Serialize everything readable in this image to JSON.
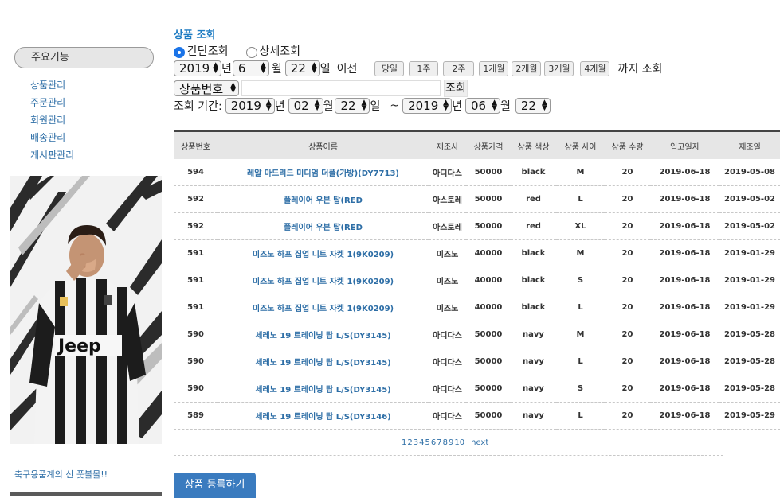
{
  "sidebar": {
    "menu_title": "주요기능",
    "items": [
      {
        "label": "상품관리"
      },
      {
        "label": "주문관리"
      },
      {
        "label": "회원관리"
      },
      {
        "label": "배송관리"
      },
      {
        "label": "게시판관리"
      }
    ],
    "caption": "축구용품계의 신 풋볼몰!!"
  },
  "search": {
    "title": "상품 조회",
    "radio_simple": "간단조회",
    "radio_detail": "상세조회",
    "selected_mode": "간단조회",
    "date": {
      "year": "2019",
      "month": "6",
      "day": "22"
    },
    "unit_year": "년",
    "unit_month": "월",
    "unit_day": "일",
    "before_label": "이전",
    "quick_buttons": [
      "당일",
      "1주",
      "2주",
      "1개월",
      "2개월",
      "3개월",
      "4개월"
    ],
    "until_label": "까지 조회",
    "field_select": "상품번호",
    "keyword": "",
    "search_button": "조회",
    "period_label": "조회 기간:",
    "period_from": {
      "year": "2019",
      "month": "02",
      "day": "22"
    },
    "tilde": "~",
    "period_to": {
      "year": "2019",
      "month": "06",
      "day": "22"
    }
  },
  "table": {
    "headers": [
      "상품번호",
      "상품이름",
      "제조사",
      "상품가격",
      "상품 색상",
      "상품 사이",
      "상품 수량",
      "입고일자",
      "제조일"
    ],
    "rows": [
      [
        "594",
        "레알 마드리드 미디엄 더플(가방)(DY7713)",
        "아디다스",
        "50000",
        "black",
        "M",
        "20",
        "2019-06-18",
        "2019-05-08"
      ],
      [
        "592",
        "플레이어 우븐 탑(RED",
        "아스토레",
        "50000",
        "red",
        "L",
        "20",
        "2019-06-18",
        "2019-05-02"
      ],
      [
        "592",
        "플레이어 우븐 탑(RED",
        "아스토레",
        "50000",
        "red",
        "XL",
        "20",
        "2019-06-18",
        "2019-05-02"
      ],
      [
        "591",
        "미즈노 하프 집업 니트 자켓 1(9K0209)",
        "미즈노",
        "40000",
        "black",
        "M",
        "20",
        "2019-06-18",
        "2019-01-29"
      ],
      [
        "591",
        "미즈노 하프 집업 니트 자켓 1(9K0209)",
        "미즈노",
        "40000",
        "black",
        "S",
        "20",
        "2019-06-18",
        "2019-01-29"
      ],
      [
        "591",
        "미즈노 하프 집업 니트 자켓 1(9K0209)",
        "미즈노",
        "40000",
        "black",
        "L",
        "20",
        "2019-06-18",
        "2019-01-29"
      ],
      [
        "590",
        "세레노 19 트레이닝 탑 L/S(DY3145)",
        "아디다스",
        "50000",
        "navy",
        "M",
        "20",
        "2019-06-18",
        "2019-05-28"
      ],
      [
        "590",
        "세레노 19 트레이닝 탑 L/S(DY3145)",
        "아디다스",
        "50000",
        "navy",
        "L",
        "20",
        "2019-06-18",
        "2019-05-28"
      ],
      [
        "590",
        "세레노 19 트레이닝 탑 L/S(DY3145)",
        "아디다스",
        "50000",
        "navy",
        "S",
        "20",
        "2019-06-18",
        "2019-05-28"
      ],
      [
        "589",
        "세레노 19 트레이닝 탑 L/S(DY3146)",
        "아디다스",
        "50000",
        "navy",
        "L",
        "20",
        "2019-06-18",
        "2019-05-29"
      ]
    ]
  },
  "pagination": {
    "pages": [
      "1",
      "2",
      "3",
      "4",
      "5",
      "6",
      "7",
      "8",
      "9",
      "10"
    ],
    "next": "next"
  },
  "register_button": "상품 등록하기",
  "colors": {
    "link": "#2d6ea6",
    "title": "#1d7bc2",
    "button": "#3a7bbf",
    "header_bg": "#e6e6e6"
  }
}
